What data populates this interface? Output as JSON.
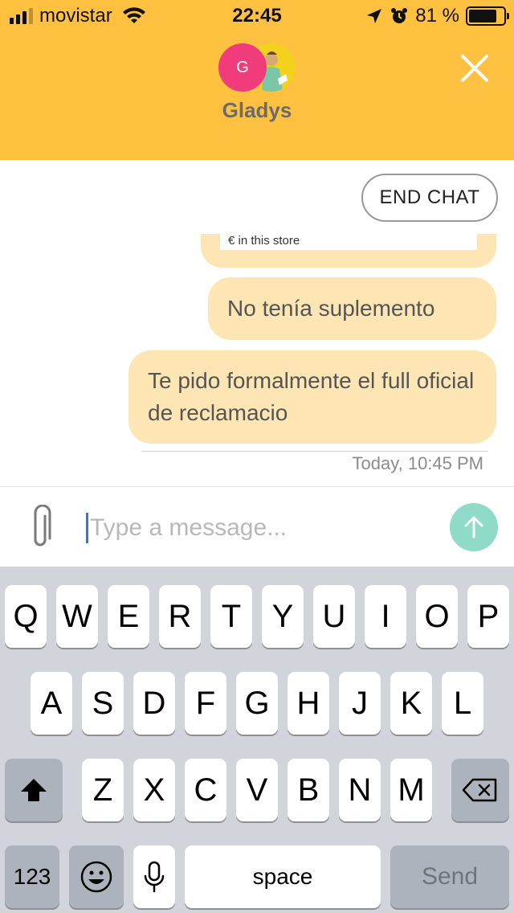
{
  "status_bar": {
    "carrier": "movistar",
    "time": "22:45",
    "battery_text": "81 %",
    "battery_level": 0.81,
    "signal_bars": 4,
    "signal_bars_active": 3,
    "icons": [
      "signal-icon",
      "wifi-icon",
      "location-arrow-icon",
      "alarm-icon",
      "battery-icon"
    ]
  },
  "header": {
    "avatar_initial": "G",
    "agent_name": "Gladys",
    "colors": {
      "header_bg": "#FFC13F",
      "avatar_bg": "#F03C7A"
    }
  },
  "chat": {
    "end_chat_label": "END CHAT",
    "card_text": "€ in this store",
    "messages": [
      {
        "text": "No tenía suplemento"
      },
      {
        "text": "Te pido formalmente el full oficial de reclamacio"
      }
    ],
    "timestamp": "Today, 10:45 PM",
    "colors": {
      "bubble_bg": "#FDE6B3",
      "send_button": "#8FDBC7"
    }
  },
  "composer": {
    "placeholder": "Type a message..."
  },
  "keyboard": {
    "row1": [
      "Q",
      "W",
      "E",
      "R",
      "T",
      "Y",
      "U",
      "I",
      "O",
      "P"
    ],
    "row2": [
      "A",
      "S",
      "D",
      "F",
      "G",
      "H",
      "J",
      "K",
      "L"
    ],
    "row3": [
      "Z",
      "X",
      "C",
      "V",
      "B",
      "N",
      "M"
    ],
    "numbers_label": "123",
    "space_label": "space",
    "send_label": "Send"
  }
}
